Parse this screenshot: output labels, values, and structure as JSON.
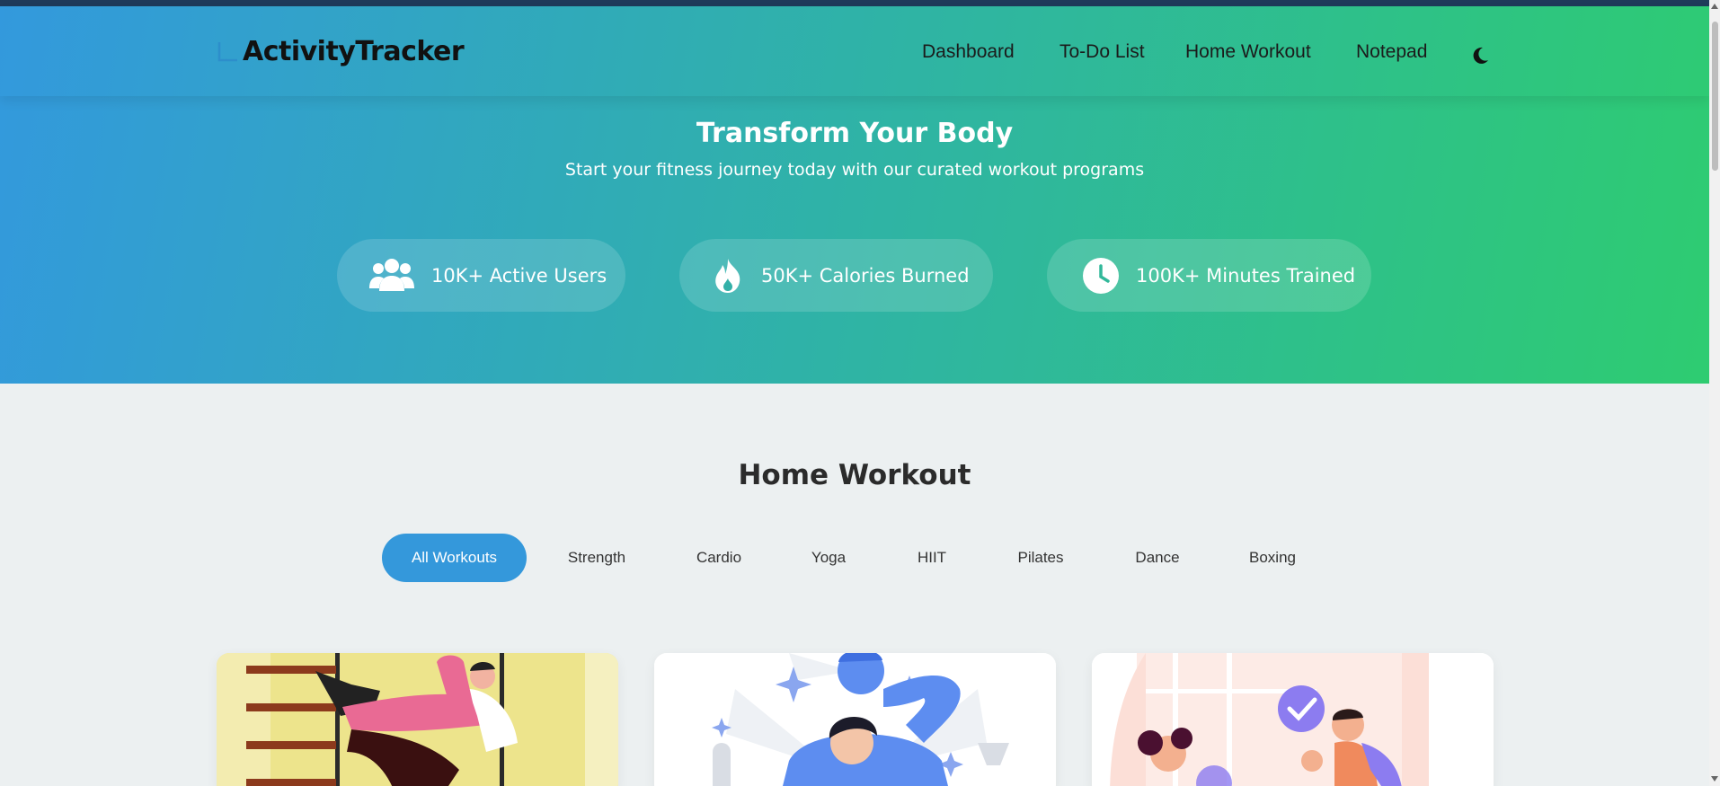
{
  "brand": {
    "name": "ActivityTracker",
    "icon": "chart-icon"
  },
  "nav": {
    "items": [
      {
        "label": "Dashboard"
      },
      {
        "label": "To-Do List"
      },
      {
        "label": "Home Workout"
      },
      {
        "label": "Notepad"
      }
    ],
    "theme_toggle_icon": "moon-icon"
  },
  "hero": {
    "title": "Transform Your Body",
    "subtitle": "Start your fitness journey today with our curated workout programs",
    "stats": [
      {
        "icon": "users-icon",
        "label": "10K+ Active Users"
      },
      {
        "icon": "fire-icon",
        "label": "50K+ Calories Burned"
      },
      {
        "icon": "clock-icon",
        "label": "100K+ Minutes Trained"
      }
    ]
  },
  "workouts": {
    "title": "Home Workout",
    "filters": [
      {
        "label": "All Workouts",
        "active": true
      },
      {
        "label": "Strength",
        "active": false
      },
      {
        "label": "Cardio",
        "active": false
      },
      {
        "label": "Yoga",
        "active": false
      },
      {
        "label": "HIIT",
        "active": false
      },
      {
        "label": "Pilates",
        "active": false
      },
      {
        "label": "Dance",
        "active": false
      },
      {
        "label": "Boxing",
        "active": false
      }
    ],
    "cards": [
      {
        "illustration": "wall-bars-stretch-illustration"
      },
      {
        "illustration": "self-confidence-illustration"
      },
      {
        "illustration": "celebration-illustration"
      }
    ]
  },
  "colors": {
    "hero_gradient_start": "#3399dd",
    "hero_gradient_end": "#2ecc71",
    "accent": "#3498db",
    "background": "#ecf0f1"
  }
}
